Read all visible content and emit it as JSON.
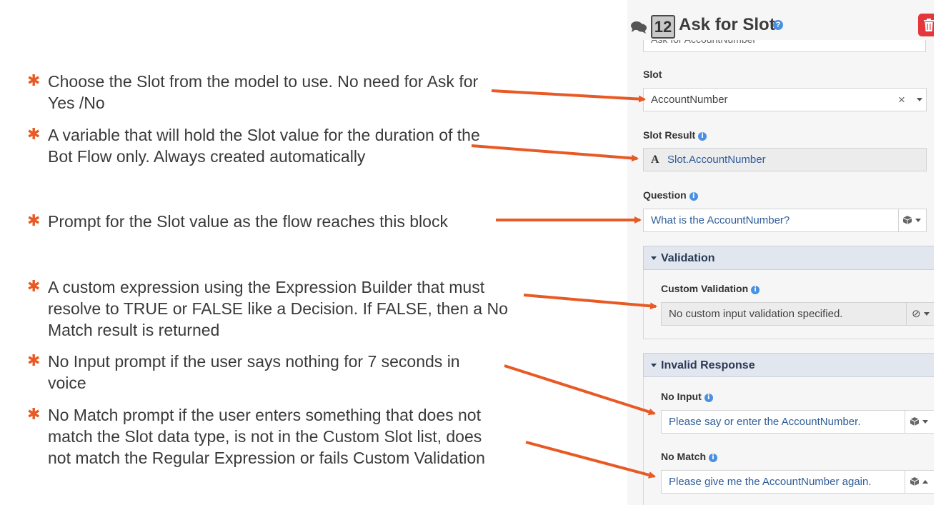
{
  "annotations": [
    {
      "lines": [
        "Choose the Slot from the model to use. No need for Ask for",
        "Yes /No"
      ]
    },
    {
      "lines": [
        "A variable that will hold the Slot value for the duration of the",
        "Bot Flow only. Always created automatically"
      ]
    },
    {
      "lines": [
        "Prompt for the Slot value as the flow reaches this block"
      ]
    },
    {
      "lines": [
        "A custom expression using the Expression Builder that must",
        "resolve to TRUE or FALSE like a Decision. If FALSE, then a No",
        "Match result is returned"
      ]
    },
    {
      "lines": [
        "No Input prompt if the user says nothing for 7 seconds in",
        "voice"
      ]
    },
    {
      "lines": [
        "No Match prompt if the user enters something that does not",
        "match the Slot data type, is not in the Custom Slot list, does",
        "not match the Regular Expression or fails Custom Validation"
      ]
    }
  ],
  "panel": {
    "number": "12",
    "title": "Ask for Slot",
    "help_icon": "question-circle-icon",
    "delete_icon": "trash-icon",
    "name_value": "Ask for AccountNumber",
    "slot": {
      "label": "Slot",
      "value": "AccountNumber",
      "clear": "×"
    },
    "slot_result": {
      "label": "Slot Result",
      "value": "Slot.AccountNumber",
      "type_glyph": "A"
    },
    "question": {
      "label": "Question",
      "value": "What is the AccountNumber?"
    },
    "validation": {
      "title": "Validation",
      "custom_label": "Custom Validation",
      "custom_value": "No custom input validation specified."
    },
    "invalid_response": {
      "title": "Invalid Response",
      "no_input_label": "No Input",
      "no_input_value": "Please say or enter the AccountNumber.",
      "no_match_label": "No Match",
      "no_match_value": "Please give me the AccountNumber again."
    }
  },
  "colors": {
    "accent": "#e85a25",
    "link_blue": "#2e5c99",
    "delete_red": "#e4373b",
    "section_bg": "#e2e7ef"
  }
}
